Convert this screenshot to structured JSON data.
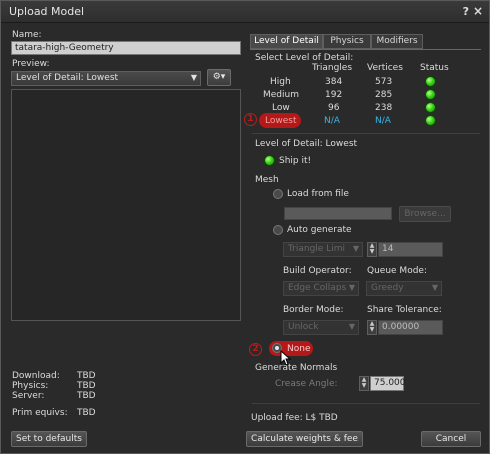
{
  "window": {
    "title": "Upload Model",
    "help": "?",
    "close": "×"
  },
  "left": {
    "name_label": "Name:",
    "name_value": "tatara-high-Geometry",
    "preview_label": "Preview:",
    "preview_select": "Level of Detail: Lowest",
    "gear_label": "⚙▾",
    "stats": [
      {
        "label": "Download:",
        "value": "TBD"
      },
      {
        "label": "Physics:",
        "value": "TBD"
      },
      {
        "label": "Server:",
        "value": "TBD"
      }
    ],
    "prim_label": "Prim equivs:",
    "prim_value": "TBD",
    "set_defaults": "Set to defaults"
  },
  "tabs": [
    {
      "label": "Level of Detail"
    },
    {
      "label": "Physics"
    },
    {
      "label": "Modifiers"
    }
  ],
  "lod": {
    "select_label": "Select Level of Detail:",
    "headers": {
      "triangles": "Triangles",
      "vertices": "Vertices",
      "status": "Status"
    },
    "rows": [
      {
        "name": "High",
        "triangles": "384",
        "vertices": "573"
      },
      {
        "name": "Medium",
        "triangles": "192",
        "vertices": "285"
      },
      {
        "name": "Low",
        "triangles": "96",
        "vertices": "238"
      },
      {
        "name": "Lowest",
        "triangles": "N/A",
        "vertices": "N/A"
      }
    ],
    "lod_title": "Level of Detail: Lowest",
    "ship_it": "Ship it!",
    "mesh_label": "Mesh",
    "load_from_file": "Load from file",
    "browse": "Browse...",
    "auto_generate": "Auto generate",
    "triangle_limit": "Triangle Limi",
    "triangle_value": "14",
    "build_operator_label": "Build Operator:",
    "build_operator_value": "Edge Collaps",
    "queue_mode_label": "Queue Mode:",
    "queue_mode_value": "Greedy",
    "border_mode_label": "Border Mode:",
    "border_mode_value": "Unlock",
    "share_tolerance_label": "Share Tolerance:",
    "share_tolerance_value": "0.00000",
    "none_label": "None",
    "generate_normals": "Generate Normals",
    "crease_angle_label": "Crease Angle:",
    "crease_angle_value": "75.000",
    "upload_fee": "Upload fee: L$ TBD"
  },
  "annotations": {
    "one": "1",
    "two": "2"
  },
  "buttons": {
    "calculate": "Calculate weights & fee",
    "cancel": "Cancel"
  },
  "colors": {
    "highlight": "#b51818",
    "status_ok": "#3bd21a",
    "na_text": "#3ab4e6"
  }
}
